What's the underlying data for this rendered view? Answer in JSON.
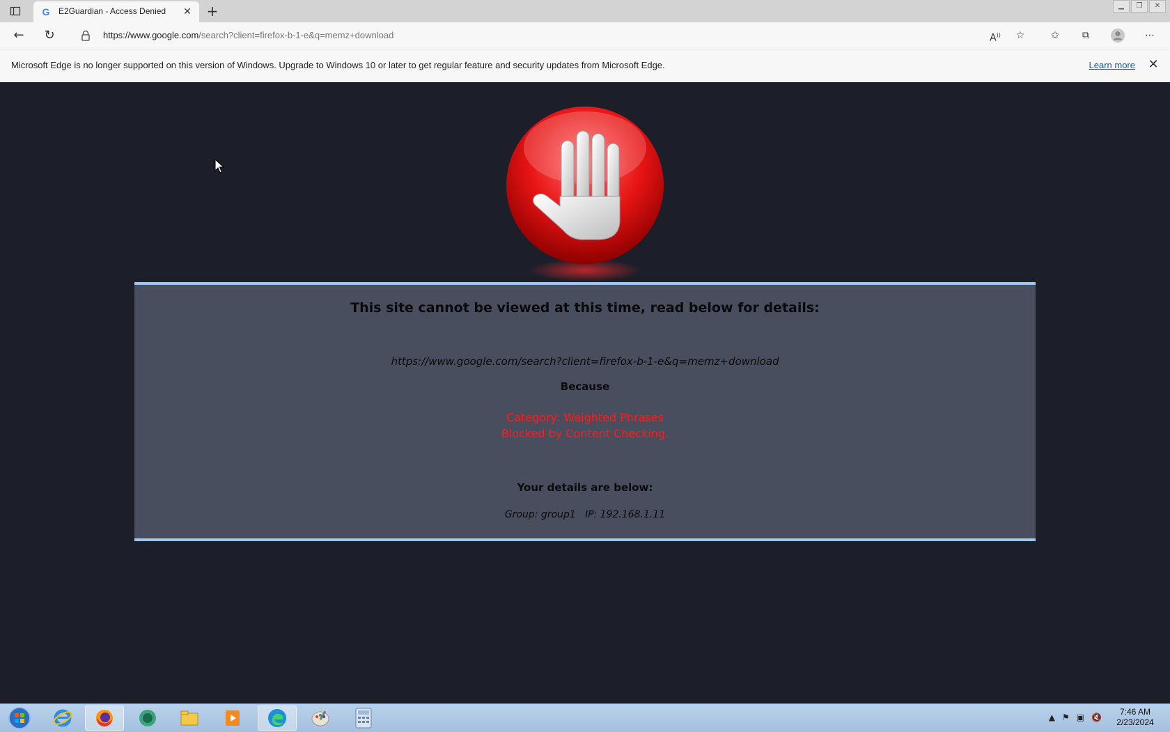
{
  "browser": {
    "tab_title": "E2Guardian - Access Denied",
    "url_host": "https://www.google.com",
    "url_rest": "/search?client=firefox-b-1-e&q=memz+download"
  },
  "infobar": {
    "message": "Microsoft Edge is no longer supported on this version of Windows. Upgrade to Windows 10 or later to get regular feature and security updates from Microsoft Edge.",
    "learn_more": "Learn more"
  },
  "page": {
    "heading": "This site cannot be viewed at this time, read below for details:",
    "blocked_url": "https://www.google.com/search?client=firefox-b-1-e&q=memz+download",
    "because": "Because",
    "reason_line1": "Category: Weighted Phrases",
    "reason_line2": "Blocked by Content Checking.",
    "details_heading": "Your details are below:",
    "user_details": "Group: group1   IP: 192.168.1.11"
  },
  "taskbar": {
    "time": "7:46 AM",
    "date": "2/23/2024",
    "apps": [
      "start-orb",
      "internet-explorer",
      "firefox",
      "messenger",
      "file-explorer",
      "media-player",
      "edge",
      "paint",
      "calculator"
    ]
  },
  "colors": {
    "page_bg": "#1c1f2a",
    "panel_bg": "#484e5e",
    "panel_border": "#9cc7f4",
    "reason_red": "#ff1b1b"
  }
}
